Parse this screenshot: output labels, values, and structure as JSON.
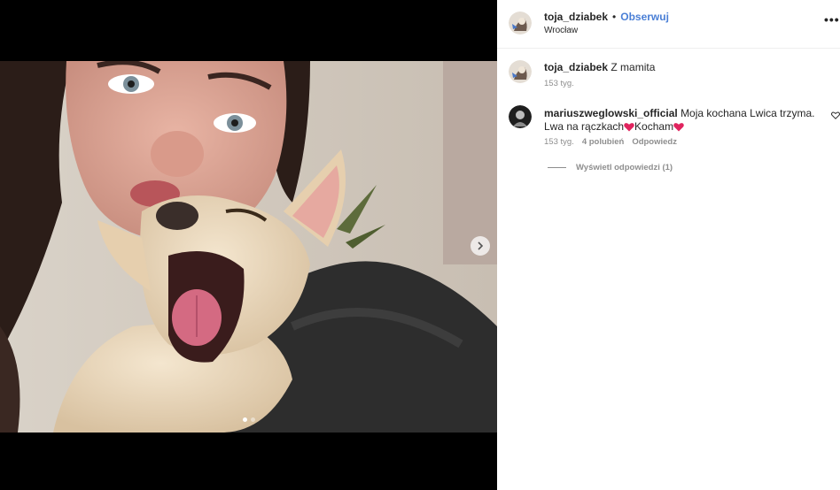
{
  "post": {
    "author": "toja_dziabek",
    "follow_label": "Obserwuj",
    "separator": "•",
    "location": "Wrocław",
    "more_label": "•••",
    "carousel": {
      "slide_count": 2,
      "active_index": 0
    }
  },
  "caption": {
    "author": "toja_dziabek",
    "text": "Z mamita",
    "time": "153 tyg."
  },
  "comments": [
    {
      "author": "mariuszweglowski_official",
      "text_part1": "Moja kochana Lwica trzyma. Lwa na rączkach",
      "text_part2": "Kocham",
      "emoji": "red-heart",
      "time": "153 tyg.",
      "likes": "4 polubień",
      "reply_label": "Odpowiedz",
      "view_replies": "Wyświetl odpowiedzi (1)"
    }
  ],
  "colors": {
    "follow": "#4a7fd6",
    "heart": "#e0245e",
    "meta": "#8e8e8e"
  },
  "icons": [
    "next-arrow-icon",
    "more-options-icon",
    "like-heart-icon",
    "red-heart-emoji"
  ]
}
